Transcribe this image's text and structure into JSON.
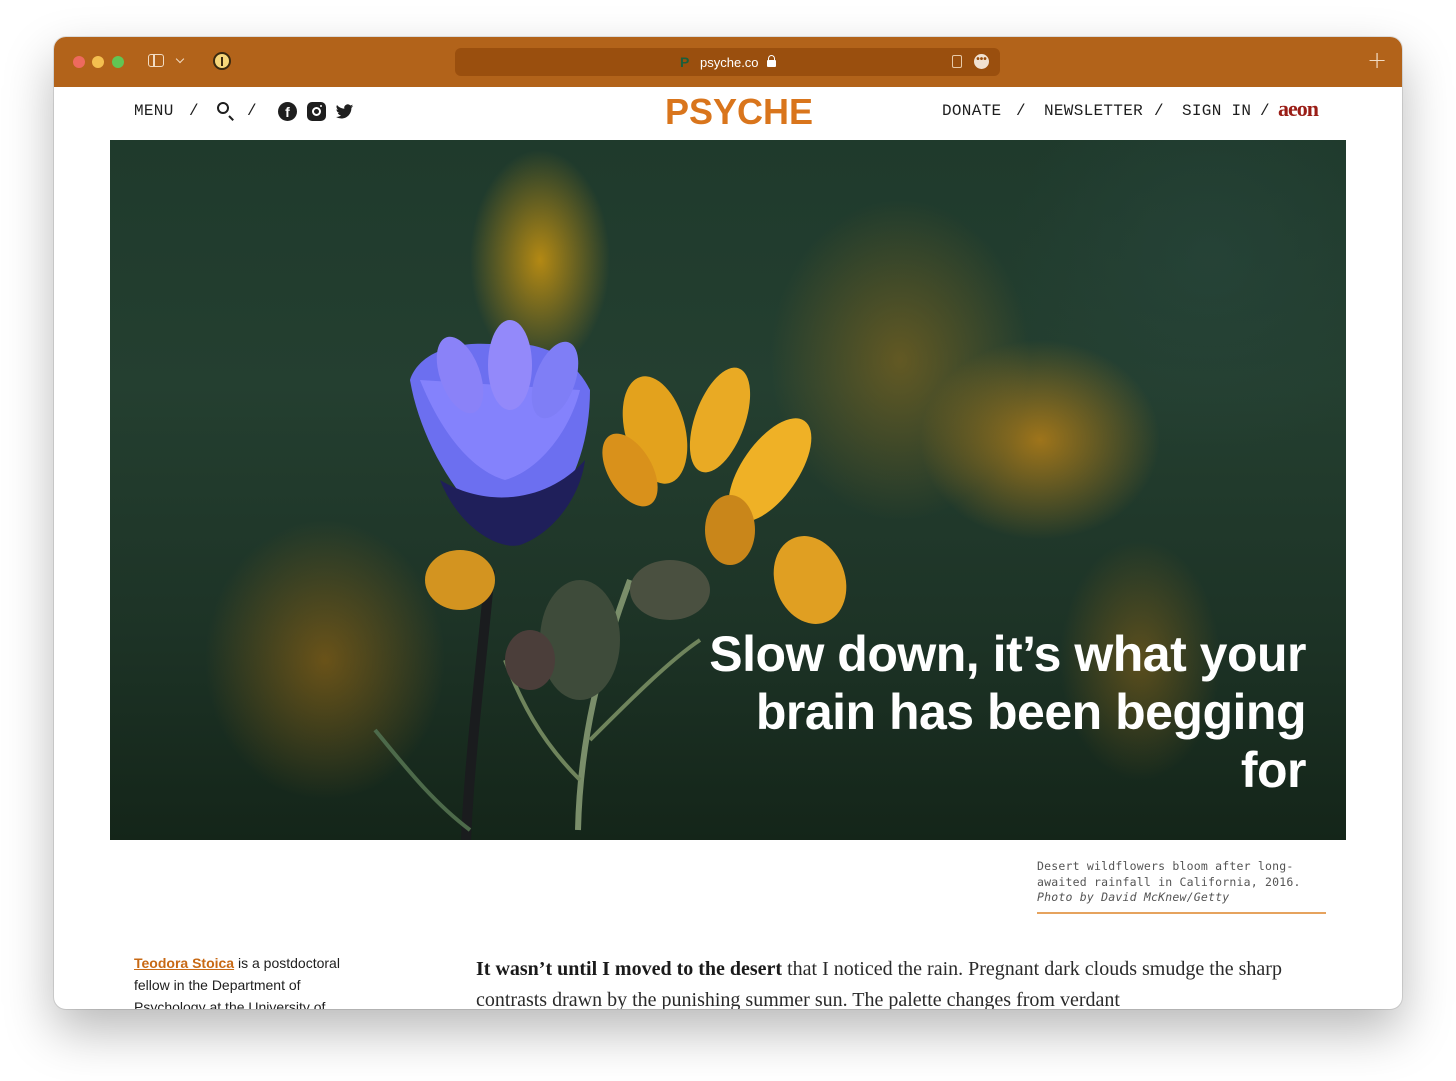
{
  "browser": {
    "url": "psyche.co",
    "favicon": "P",
    "more_glyph": "•••",
    "new_tab_glyph": "+"
  },
  "header": {
    "menu": "MENU",
    "sep": "/",
    "donate": "DONATE",
    "newsletter": "NEWSLETTER",
    "sign_in": "SIGN IN",
    "logo": "PSYCHE",
    "partner_logo": "aeon",
    "facebook_glyph": "f",
    "icons": [
      "search-icon",
      "facebook-icon",
      "instagram-icon",
      "twitter-icon"
    ]
  },
  "hero": {
    "headline": "Slow down, it’s what your brain has been begging for",
    "caption_text": "Desert wildflowers bloom after long-awaited rainfall in California, 2016.",
    "caption_credit": "Photo by David McKnew/Getty"
  },
  "article": {
    "author_name": "Teodora Stoica",
    "author_bio": " is a postdoctoral fellow in the Department of Psychology at the University of",
    "lead_bold": "It wasn’t until I moved to the desert",
    "lead_rest": " that I noticed the rain. Pregnant dark clouds smudge the sharp contrasts drawn by the punishing summer sun. The palette changes from verdant"
  },
  "colors": {
    "chrome": "#b2631a",
    "brand": "#d9751c",
    "partner": "#9a1d16",
    "caption_rule": "#e6a35e"
  }
}
